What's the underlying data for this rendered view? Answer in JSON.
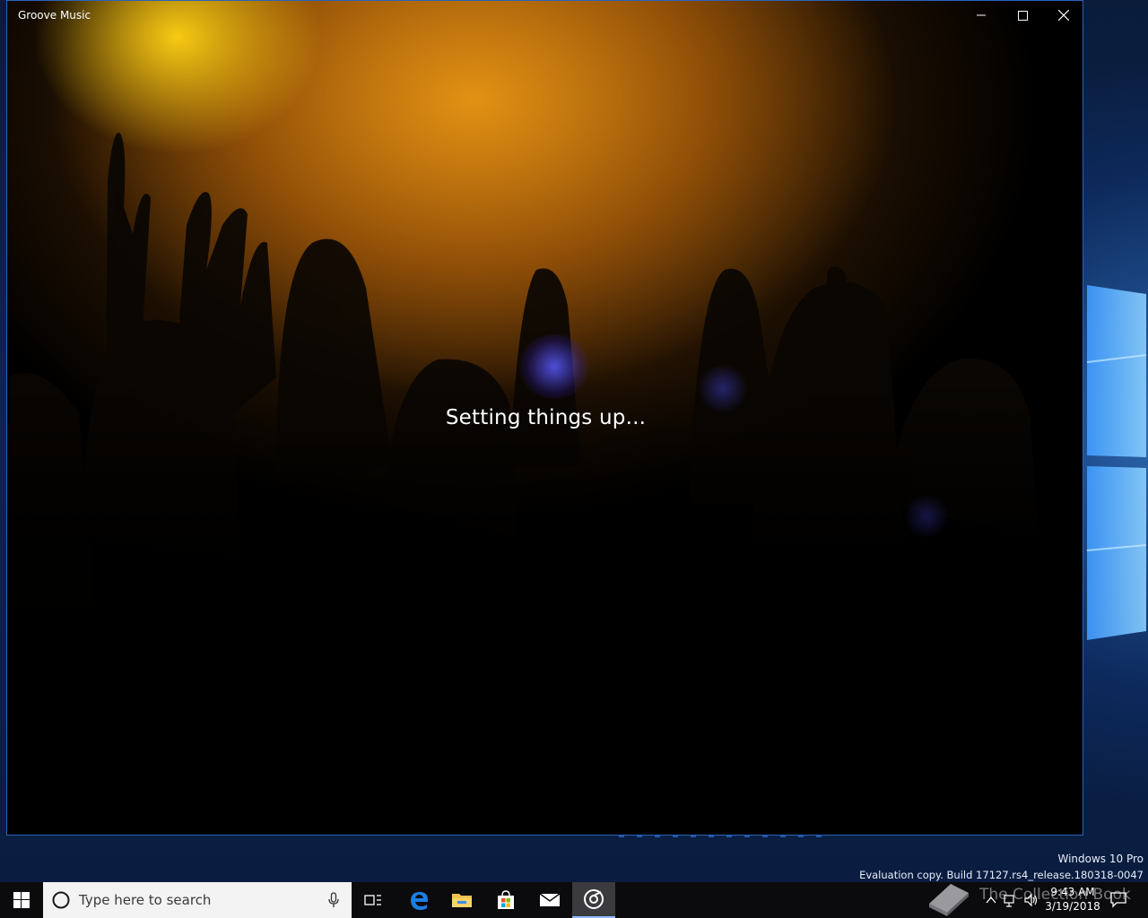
{
  "window": {
    "title": "Groove Music",
    "status_message": "Setting things up...",
    "minimize_icon": "minimize-icon",
    "maximize_icon": "maximize-icon",
    "close_icon": "close-icon"
  },
  "desktop": {
    "watermark_line1": "Windows 10 Pro",
    "watermark_line2": "Evaluation copy. Build 17127.rs4_release.180318-0047",
    "overlay_text": "The Collection Book"
  },
  "taskbar": {
    "search_placeholder": "Type here to search",
    "clock_time": "9:43 AM",
    "clock_date": "3/19/2018",
    "pinned_apps": [
      "task-view",
      "edge",
      "file-explorer",
      "store",
      "mail",
      "groove-music"
    ],
    "active_app": "groove-music"
  },
  "colors": {
    "window_border": "#2a63b8",
    "taskbar": "#0b0b0d",
    "accent": "#0078d7"
  }
}
